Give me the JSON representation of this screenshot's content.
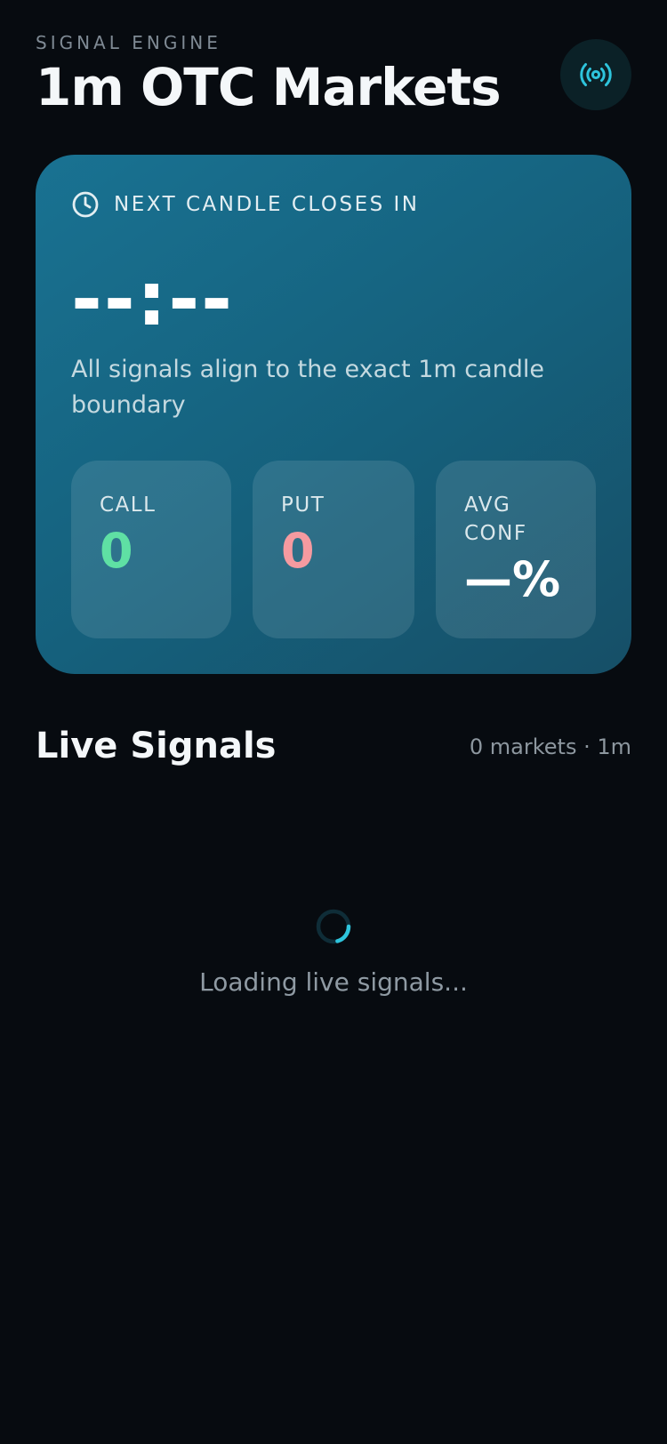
{
  "header": {
    "eyebrow": "SIGNAL ENGINE",
    "title": "1m OTC Markets",
    "live_icon": "broadcast-signal-icon"
  },
  "countdown_card": {
    "clock_icon": "clock-icon",
    "label": "NEXT CANDLE CLOSES IN",
    "countdown": "--:--",
    "description": "All signals align to the exact 1m candle boundary",
    "stats": {
      "call": {
        "label": "CALL",
        "value": "0"
      },
      "put": {
        "label": "PUT",
        "value": "0"
      },
      "avg_conf": {
        "label": "AVG CONF",
        "value": "—%"
      }
    }
  },
  "live_signals": {
    "title": "Live Signals",
    "meta": "0 markets · 1m",
    "loading_text": "Loading live signals..."
  },
  "colors": {
    "background": "#070b10",
    "accent_cyan": "#2ec4dc",
    "call_green": "#5fe0a4",
    "put_red": "#f59aa0",
    "card_teal": "#197292"
  }
}
